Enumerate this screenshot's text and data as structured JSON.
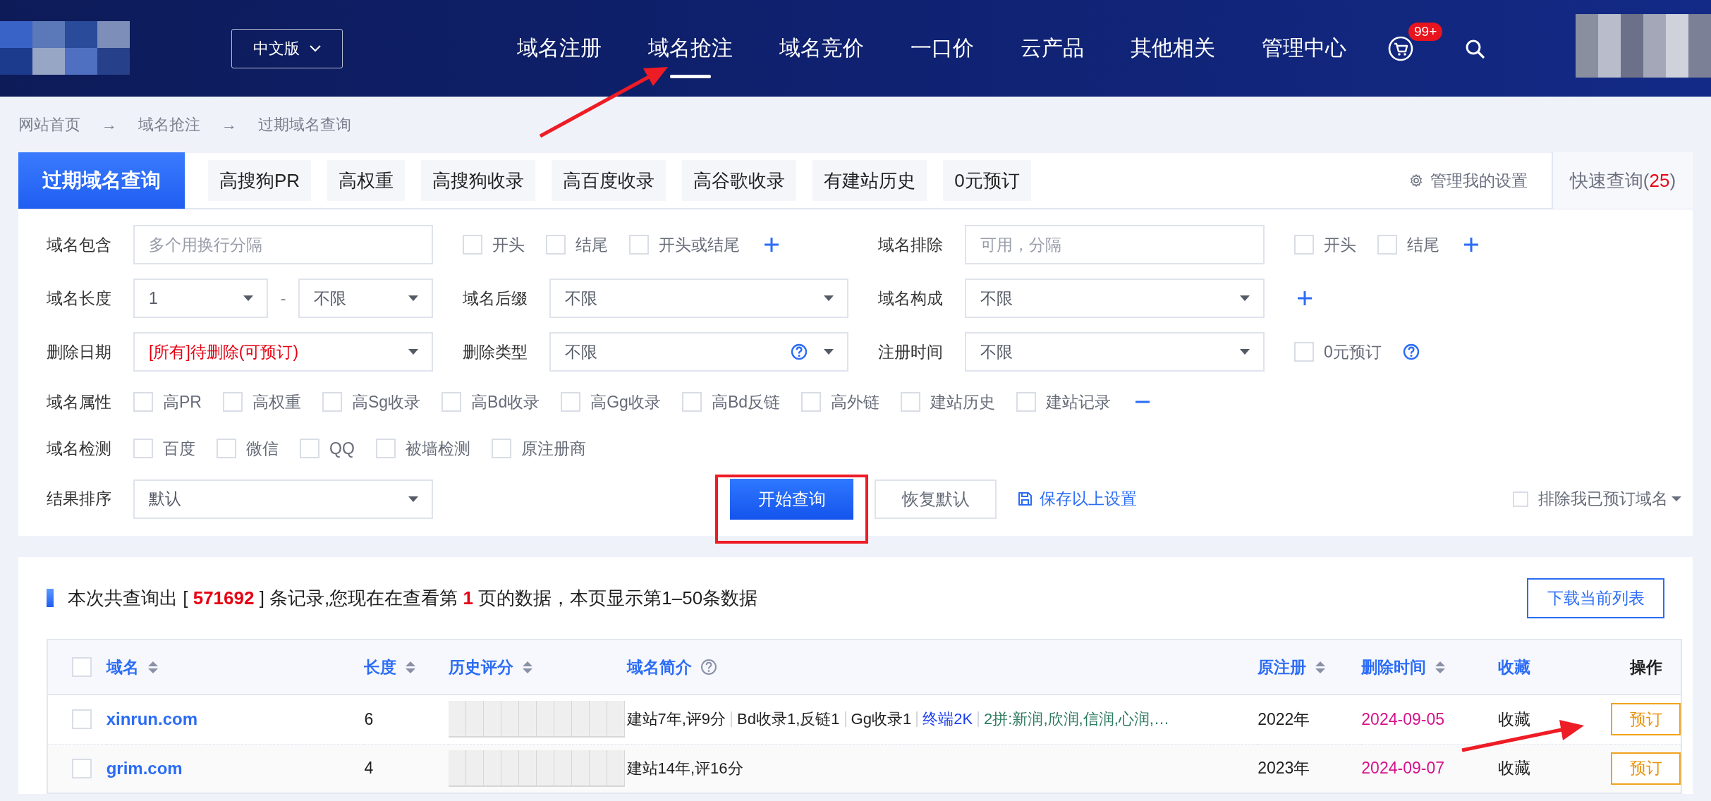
{
  "header": {
    "language": "中文版",
    "cart_badge": "99+",
    "nav": [
      {
        "label": "域名注册",
        "selected": false
      },
      {
        "label": "域名抢注",
        "selected": true
      },
      {
        "label": "域名竞价",
        "selected": false
      },
      {
        "label": "一口价",
        "selected": false
      },
      {
        "label": "云产品",
        "selected": false
      },
      {
        "label": "其他相关",
        "selected": false
      },
      {
        "label": "管理中心",
        "selected": false
      }
    ]
  },
  "breadcrumb": {
    "items": [
      "网站首页",
      "域名抢注",
      "过期域名查询"
    ],
    "separators": [
      "→",
      "→"
    ]
  },
  "tabs": [
    {
      "label": "过期域名查询",
      "selected": true
    },
    {
      "label": "高搜狗PR",
      "selected": false
    },
    {
      "label": "高权重",
      "selected": false
    },
    {
      "label": "高搜狗收录",
      "selected": false
    },
    {
      "label": "高百度收录",
      "selected": false
    },
    {
      "label": "高谷歌收录",
      "selected": false
    },
    {
      "label": "有建站历史",
      "selected": false
    },
    {
      "label": "0元预订",
      "selected": false
    }
  ],
  "settings_link": "管理我的设置",
  "quick_query": {
    "label": "快速查询(",
    "count": "25",
    "close": ")"
  },
  "filter_rows": [
    {
      "segments": [
        [
          {
            "kind": "label",
            "text": "域名包含"
          },
          {
            "kind": "input",
            "placeholder": "多个用换行分隔"
          },
          {
            "kind": "checkbox",
            "label": "开头",
            "checked": false
          },
          {
            "kind": "checkbox",
            "label": "结尾",
            "checked": false
          },
          {
            "kind": "checkbox",
            "label": "开头或结尾",
            "checked": false
          },
          {
            "kind": "add"
          }
        ],
        [
          {
            "kind": "label",
            "text": "域名排除"
          },
          {
            "kind": "input",
            "placeholder": "可用，分隔"
          },
          {
            "kind": "checkbox",
            "label": "开头",
            "checked": false
          },
          {
            "kind": "checkbox",
            "label": "结尾",
            "checked": false
          },
          {
            "kind": "add"
          }
        ]
      ]
    },
    {
      "segments": [
        [
          {
            "kind": "label",
            "text": "域名长度"
          },
          {
            "kind": "range",
            "from": "1",
            "dash": "-",
            "to": "不限"
          },
          {
            "kind": "label",
            "text": "域名后缀"
          },
          {
            "kind": "select",
            "value": "不限",
            "alert": false,
            "help": false
          }
        ],
        [
          {
            "kind": "label",
            "text": "域名构成"
          },
          {
            "kind": "select",
            "value": "不限",
            "alert": false,
            "help": false
          },
          {
            "kind": "add"
          }
        ]
      ]
    },
    {
      "segments": [
        [
          {
            "kind": "label",
            "text": "删除日期"
          },
          {
            "kind": "select",
            "value": "[所有]待删除(可预订)",
            "alert": true,
            "help": false
          },
          {
            "kind": "label",
            "text": "删除类型"
          },
          {
            "kind": "select",
            "value": "不限",
            "alert": false,
            "help": true
          }
        ],
        [
          {
            "kind": "label",
            "text": "注册时间"
          },
          {
            "kind": "select",
            "value": "不限",
            "alert": false,
            "help": false
          },
          {
            "kind": "checkbox",
            "label": "0元预订",
            "checked": false
          },
          {
            "kind": "help"
          }
        ]
      ]
    },
    {
      "segments": [
        [
          {
            "kind": "label",
            "text": "域名属性"
          },
          {
            "kind": "checkbox",
            "label": "高PR",
            "checked": false
          },
          {
            "kind": "checkbox",
            "label": "高权重",
            "checked": false
          },
          {
            "kind": "checkbox",
            "label": "高Sg收录",
            "checked": false
          },
          {
            "kind": "checkbox",
            "label": "高Bd收录",
            "checked": false
          },
          {
            "kind": "checkbox",
            "label": "高Gg收录",
            "checked": false
          },
          {
            "kind": "checkbox",
            "label": "高Bd反链",
            "checked": false
          },
          {
            "kind": "checkbox",
            "label": "高外链",
            "checked": false
          },
          {
            "kind": "checkbox",
            "label": "建站历史",
            "checked": false
          },
          {
            "kind": "checkbox",
            "label": "建站记录",
            "checked": false
          },
          {
            "kind": "remove"
          }
        ]
      ]
    },
    {
      "segments": [
        [
          {
            "kind": "label",
            "text": "域名检测"
          },
          {
            "kind": "checkbox",
            "label": "百度",
            "checked": false
          },
          {
            "kind": "checkbox",
            "label": "微信",
            "checked": false
          },
          {
            "kind": "checkbox",
            "label": "QQ",
            "checked": false
          },
          {
            "kind": "checkbox",
            "label": "被墙检测",
            "checked": false
          },
          {
            "kind": "checkbox",
            "label": "原注册商",
            "checked": false
          }
        ]
      ]
    }
  ],
  "actions": {
    "sort_label": "结果排序",
    "sort_value": "默认",
    "search_button": "开始查询",
    "reset_button": "恢复默认",
    "save_link": "保存以上设置",
    "exclude": {
      "label": "排除我已预订域名",
      "checked": false
    }
  },
  "results": {
    "summary": [
      {
        "text": "本次共查询出 [ ",
        "highlight": false
      },
      {
        "text": "571692",
        "highlight": true
      },
      {
        "text": " ] 条记录,您现在在查看第 ",
        "highlight": false
      },
      {
        "text": "1",
        "highlight": true
      },
      {
        "text": " 页的数据，本页显示第1–50条数据",
        "highlight": false
      }
    ],
    "download_button": "下载当前列表"
  },
  "table": {
    "columns": [
      {
        "label": "域名",
        "kind": "field",
        "sortable": true,
        "help": false
      },
      {
        "label": "长度",
        "kind": "field",
        "sortable": true,
        "help": false
      },
      {
        "label": "历史评分",
        "kind": "field",
        "sortable": true,
        "help": false
      },
      {
        "label": "域名简介",
        "kind": "field",
        "sortable": false,
        "help": true
      },
      {
        "label": "原注册",
        "kind": "field",
        "sortable": true,
        "help": false
      },
      {
        "label": "删除时间",
        "kind": "field",
        "sortable": true,
        "help": false
      },
      {
        "label": "收藏",
        "kind": "field",
        "sortable": false,
        "help": false
      },
      {
        "label": "操作",
        "kind": "action",
        "sortable": false,
        "help": false
      }
    ],
    "header_checked": false,
    "rows": [
      {
        "selected": false,
        "domain": "xinrun.com",
        "length": "6",
        "intro": [
          {
            "text": "建站7年,评9分",
            "color": "#1f1f1f"
          },
          {
            "text": "Bd收录1,反链1",
            "color": "#1f1f1f"
          },
          {
            "text": "Gg收录1",
            "color": "#1f1f1f"
          },
          {
            "text": "终端2K",
            "color": "#1b3ff0"
          },
          {
            "text": "2拼:新润,欣润,信润,心润,…",
            "color": "#2d7a5e"
          }
        ],
        "registered": "2022年",
        "deleted": "2024-09-05",
        "favorite": "收藏",
        "action": "预订"
      },
      {
        "selected": false,
        "domain": "grim.com",
        "length": "4",
        "intro": [
          {
            "text": "建站14年,评16分",
            "color": "#1f1f1f"
          }
        ],
        "registered": "2023年",
        "deleted": "2024-09-07",
        "favorite": "收藏",
        "action": "预订"
      }
    ]
  }
}
